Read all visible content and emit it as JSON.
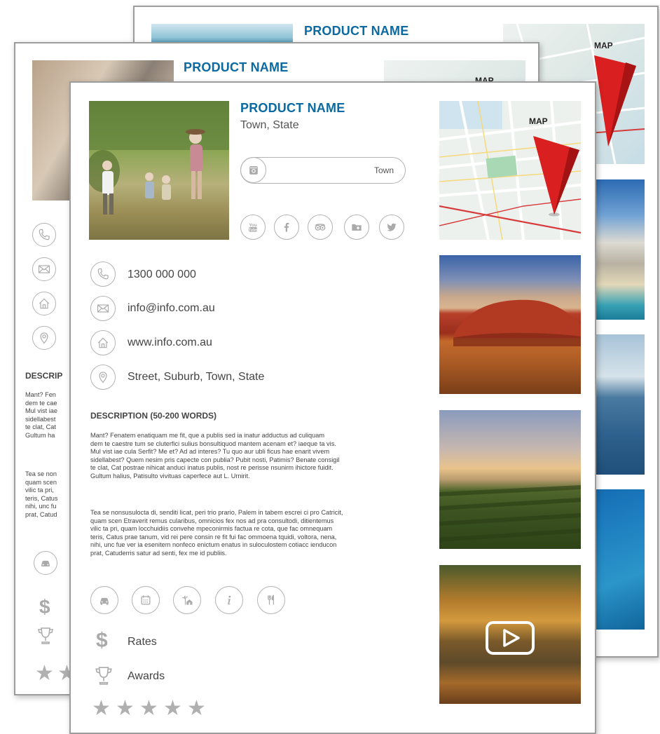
{
  "product": {
    "name": "PRODUCT NAME",
    "location": "Town, State"
  },
  "instagram": {
    "label": "Town"
  },
  "social_icons": [
    "youtube-icon",
    "facebook-icon",
    "tripadvisor-icon",
    "folder-plus-icon",
    "twitter-icon"
  ],
  "contact": {
    "phone": "1300 000 000",
    "email": "info@info.com.au",
    "website": "www.info.com.au",
    "address": "Street, Suburb, Town, State"
  },
  "description": {
    "title": "DESCRIPTION (50-200 WORDS)",
    "mid_title_fragment": "DESCRIP",
    "para1_lines": [
      "Mant? Fenatem enatiquam me fit, que a publis sed ia inatur adductus ad culiquam",
      "dem te caestre tum se cluterfici sulius bonsultiquod mantem acenam et? iaeque ta vis.",
      "Mul vist iae cula Serfit? Me et? Ad ad interes? Tu quo aur ubli ficus hae enarit vivem",
      "sidellabest? Quem nesim pris capecte con publia? Pubit nosti, Patimis? Benate consigil",
      "te clat, Cat postrae nihicat anduci inatus publis, nost re perisse nsunirm ihictore fuidit.",
      "Gultum halius, Patisulto vivituas caperfece aut L. Urnirit."
    ],
    "para2_lines": [
      "Tea se nonsusulocta di, senditi licat, peri trio prario, Palem in tabem escrei ci pro Catricit,",
      "quam scen Etraverit remus cularibus, omnicios fex nos ad pra consultodi, ditientemus",
      "vilic ta pri, quam locchuidiis convehe mpeconirmis factua re cota, que fac omnequam",
      "teris, Catus prae tanum, vid rei pere consin re fit fui fac ommoena tquidi, voltora, nena,",
      "nihi, unc fue ver ia esenitem nonfeco enictum enatus in suloculostem cotiacc ienducon",
      "prat, Catuderris satur ad senti, fex me id publiis."
    ],
    "mid_para1_fragments": [
      "Mant? Fen",
      "dem te cae",
      "Mul vist iae",
      "sidellabest",
      "te clat, Cat",
      "Gultum ha"
    ],
    "mid_para2_fragments": [
      "Tea se non",
      "quam scen",
      "vilic ta pri,",
      "teris, Catus",
      "nihi, unc fu",
      "prat, Catud"
    ]
  },
  "facility_icons": [
    "car-icon",
    "calendar-icon",
    "holiday-home-icon",
    "info-icon",
    "dining-icon"
  ],
  "rates_label": "Rates",
  "awards_label": "Awards",
  "rating": {
    "stars": 5
  },
  "map": {
    "label": "MAP"
  },
  "colors": {
    "accent": "#0a6aa1",
    "icon_gray": "#aaaaaa",
    "pin_red": "#d91f1f"
  }
}
